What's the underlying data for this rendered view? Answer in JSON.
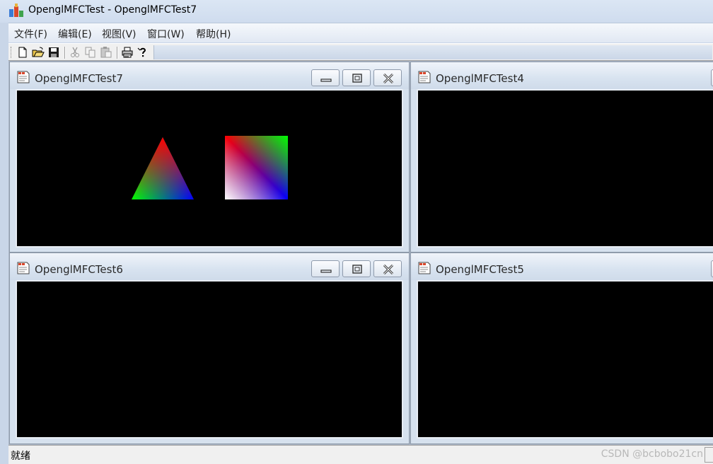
{
  "window": {
    "title": "OpenglMFCTest - OpenglMFCTest7"
  },
  "menu": [
    {
      "label": "文件(F)"
    },
    {
      "label": "编辑(E)"
    },
    {
      "label": "视图(V)"
    },
    {
      "label": "窗口(W)"
    },
    {
      "label": "帮助(H)"
    }
  ],
  "toolbar": {
    "buttons": [
      {
        "icon": "new-document-icon",
        "enabled": true
      },
      {
        "icon": "open-folder-icon",
        "enabled": true
      },
      {
        "icon": "save-icon",
        "enabled": true
      },
      {
        "icon": "cut-icon",
        "enabled": false
      },
      {
        "icon": "copy-icon",
        "enabled": false
      },
      {
        "icon": "paste-icon",
        "enabled": false
      },
      {
        "icon": "print-icon",
        "enabled": true
      },
      {
        "icon": "help-icon",
        "enabled": true
      }
    ]
  },
  "children": [
    {
      "title": "OpenglMFCTest7",
      "active": true,
      "scene": [
        "rgb-triangle",
        "rgb-square"
      ]
    },
    {
      "title": "OpenglMFCTest4",
      "active": false,
      "scene": []
    },
    {
      "title": "OpenglMFCTest6",
      "active": false,
      "scene": []
    },
    {
      "title": "OpenglMFCTest5",
      "active": false,
      "scene": []
    }
  ],
  "status": {
    "text": "就绪",
    "watermark": "CSDN @bcbobo21cn"
  },
  "colors": {
    "viewport_background": "#000000",
    "triangle_top": "#ff0000",
    "triangle_left": "#00ff00",
    "triangle_right": "#0000ff",
    "square_top_left": "#ff0000",
    "square_top_right": "#00ff00",
    "square_bottom_right": "#0000ff",
    "square_bottom_left": "#ffffff"
  }
}
